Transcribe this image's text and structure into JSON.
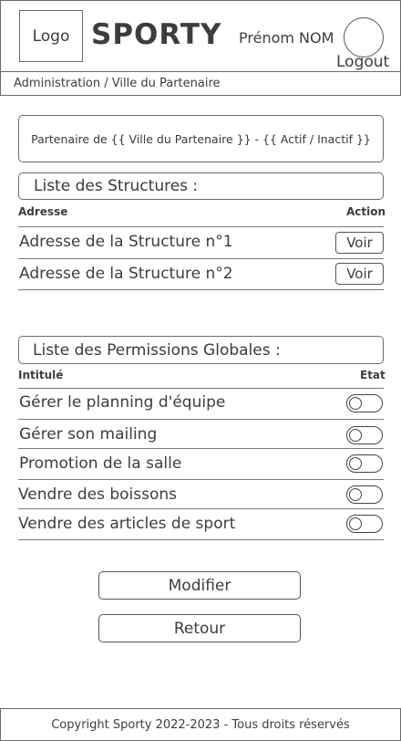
{
  "header": {
    "logo_text": "Logo",
    "brand": "SPORTY",
    "user_name": "Prénom NOM",
    "logout_label": "Logout"
  },
  "breadcrumb": "Administration / Ville du Partenaire",
  "partner_info": "Partenaire de {{ Ville du Partenaire }} - {{ Actif / Inactif }}",
  "structures": {
    "title": "Liste des Structures :",
    "col_address": "Adresse",
    "col_action": "Action",
    "rows": [
      {
        "address": "Adresse de la Structure n°1",
        "action_label": "Voir"
      },
      {
        "address": "Adresse de la Structure n°2",
        "action_label": "Voir"
      }
    ]
  },
  "permissions": {
    "title": "Liste des Permissions Globales :",
    "col_label": "Intitulé",
    "col_state": "Etat",
    "rows": [
      {
        "label": "Gérer le planning d'équipe",
        "enabled": false
      },
      {
        "label": "Gérer son mailing",
        "enabled": false
      },
      {
        "label": "Promotion de la salle",
        "enabled": false
      },
      {
        "label": "Vendre des boissons",
        "enabled": false
      },
      {
        "label": "Vendre des articles de sport",
        "enabled": false
      }
    ]
  },
  "buttons": {
    "modify_label": "Modifier",
    "back_label": "Retour"
  },
  "footer": "Copyright Sporty 2022-2023 - Tous droits réservés"
}
